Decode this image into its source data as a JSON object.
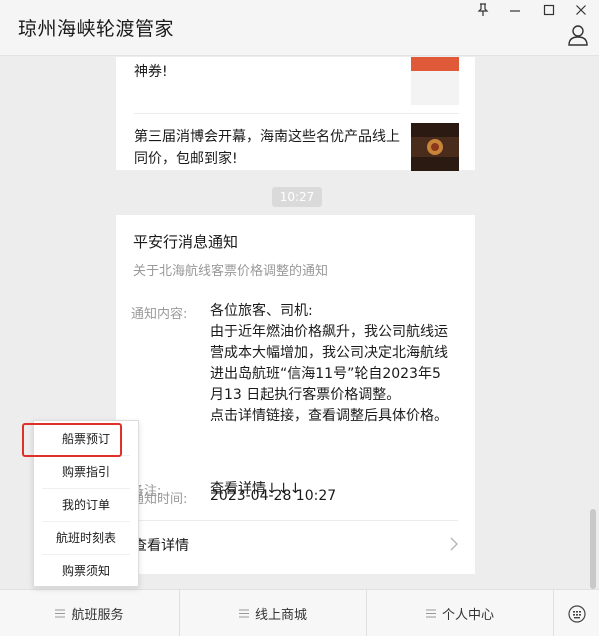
{
  "window": {
    "title": "琼州海峡轮渡管家"
  },
  "articles": [
    {
      "text_line1": "神券!",
      "text_line2": ""
    },
    {
      "text_line1": "第三届消博会开幕，海南这些名优产品线上",
      "text_line2": "同价，包邮到家!"
    }
  ],
  "time_chip": "10:27",
  "notice": {
    "title": "平安行消息通知",
    "subtitle": "关于北海航线客票价格调整的通知",
    "content_label": "通知内容:",
    "content_lines": [
      "各位旅客、司机:",
      "由于近年燃油价格飙升，我公司航线运",
      "营成本大幅增加，我公司决定北海航线",
      "进出岛航班“信海11号”轮自2023年5",
      "月13 日起执行客票价格调整。",
      "点击详情链接，查看调整后具体价格。"
    ],
    "time_label": "通知时间:",
    "time_value": "2023-04-28 10:27",
    "remark_label": "备注:",
    "remark_value": "查看详情↓↓↓",
    "detail_link": "查看详情"
  },
  "menubar": {
    "items": [
      "航班服务",
      "线上商城",
      "个人中心"
    ]
  },
  "popup": {
    "items": [
      "船票预订",
      "购票指引",
      "我的订单",
      "航班时刻表",
      "购票须知"
    ],
    "highlighted_index": 0
  },
  "colors": {
    "accent_highlight": "#e0302a",
    "background": "#ededed",
    "card": "#ffffff"
  }
}
